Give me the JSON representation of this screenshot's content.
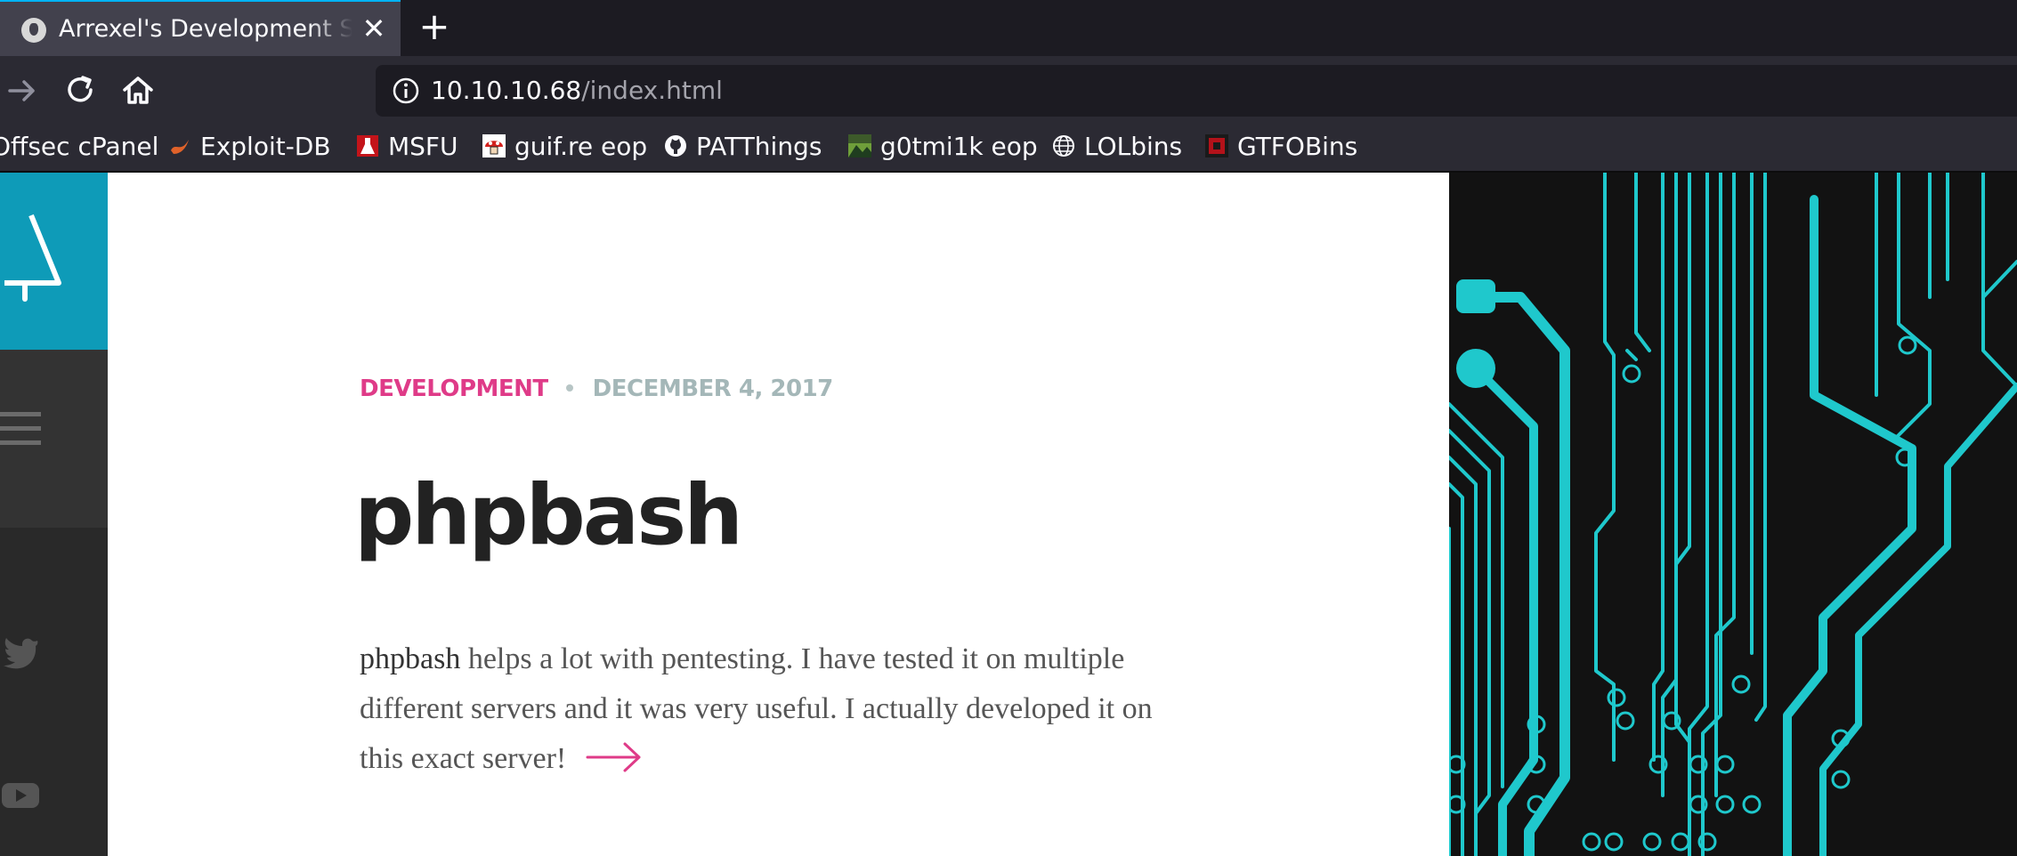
{
  "browser": {
    "tab": {
      "title": "Arrexel's Development Site",
      "close_symbol": "✕"
    },
    "new_tab_symbol": "+",
    "url": {
      "host": "10.10.10.68",
      "path": "/index.html"
    },
    "bookmarks": [
      {
        "label": "Offsec cPanel",
        "icon": "offsec-icon"
      },
      {
        "label": "Exploit-DB",
        "icon": "exploit-db-icon"
      },
      {
        "label": "MSFU",
        "icon": "msfu-icon"
      },
      {
        "label": "guif.re eop",
        "icon": "mushroom-icon"
      },
      {
        "label": "PATThings",
        "icon": "github-icon"
      },
      {
        "label": "g0tmi1k eop",
        "icon": "landscape-icon"
      },
      {
        "label": "LOLbins",
        "icon": "globe-icon"
      },
      {
        "label": "GTFOBins",
        "icon": "gtfobins-icon"
      }
    ]
  },
  "page": {
    "meta": {
      "category": "DEVELOPMENT",
      "date": "DECEMBER 4, 2017"
    },
    "title": "phpbash",
    "excerpt": {
      "strong": "phpbash",
      "rest": " helps a lot with pentesting. I have tested it on multiple different servers and it was very useful. I actually developed it on this exact server!"
    }
  },
  "colors": {
    "accent_category": "#df3b88",
    "meta_date": "#a4b7b8",
    "sidebar_logo_bg": "#0e9bb8",
    "circuit_line": "#1fc8cc",
    "circuit_bg": "#121212"
  }
}
